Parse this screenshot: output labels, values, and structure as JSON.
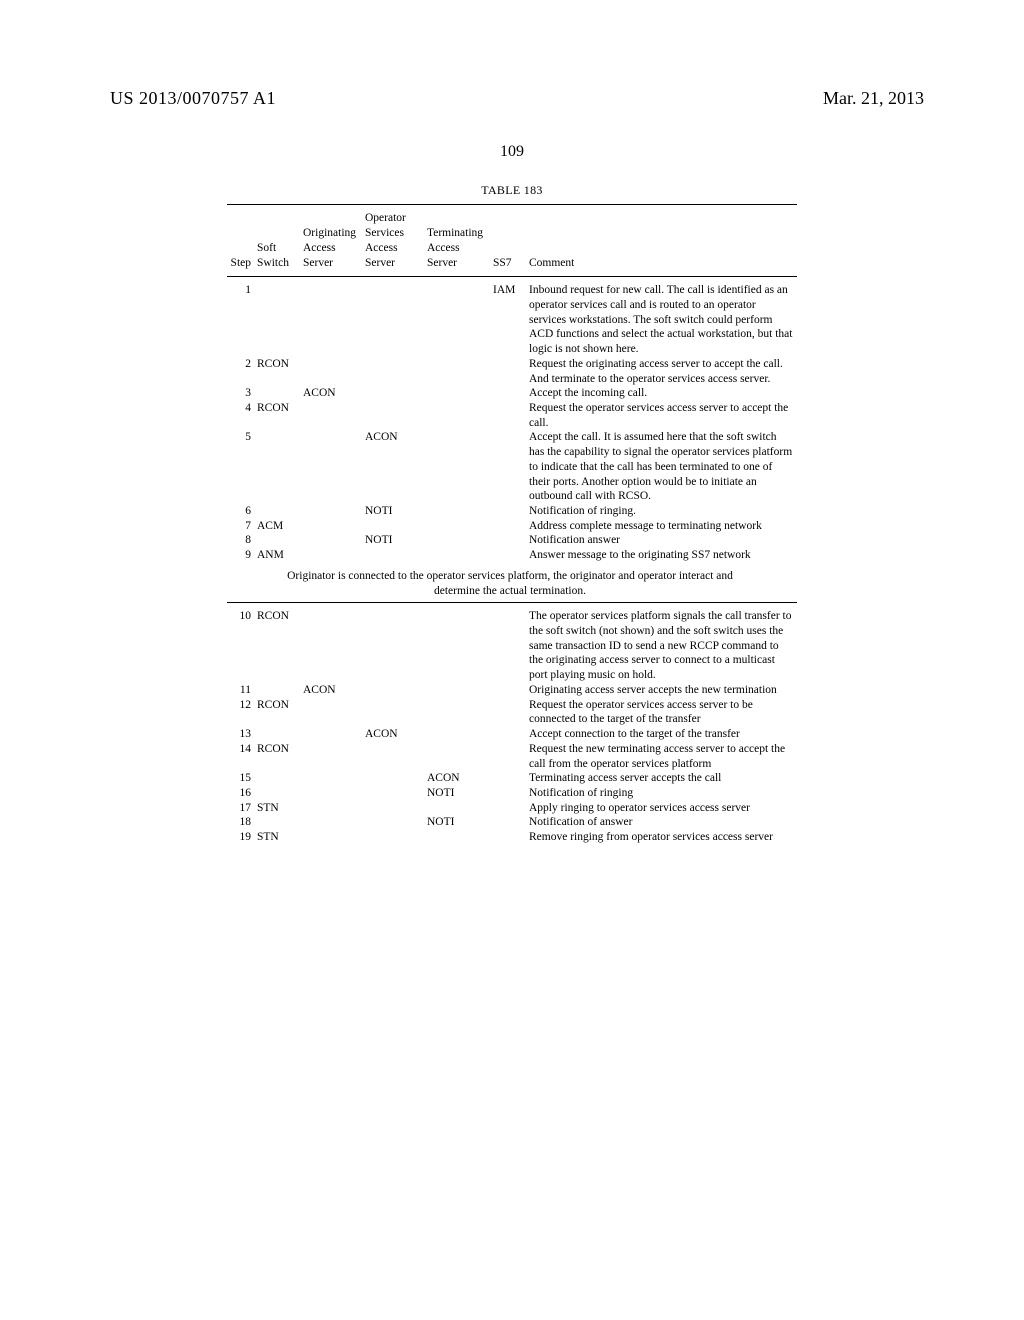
{
  "header": {
    "pub_number": "US 2013/0070757 A1",
    "pub_date": "Mar. 21, 2013",
    "page_number": "109"
  },
  "table": {
    "title": "TABLE 183",
    "columns": {
      "step": "Step",
      "soft_switch": "Soft\nSwitch",
      "orig_access": "Originating\nAccess\nServer",
      "op_services": "Operator\nServices\nAccess\nServer",
      "term_access": "Terminating\nAccess\nServer",
      "ss7": "SS7",
      "comment": "Comment"
    },
    "separator": "Originator is connected to the operator services platform, the originator and operator interact and determine the actual termination.",
    "rows_top": [
      {
        "step": "1",
        "switch": "",
        "oas": "",
        "osas": "",
        "tas": "",
        "ss7": "IAM",
        "comment": "Inbound request for new call. The call is identified as an operator services call and is routed to an operator services workstations. The soft switch could perform ACD functions and select the actual workstation, but that logic is not shown here."
      },
      {
        "step": "2",
        "switch": "RCON",
        "oas": "",
        "osas": "",
        "tas": "",
        "ss7": "",
        "comment": "Request the originating access server to accept the call. And terminate to the operator services access server."
      },
      {
        "step": "3",
        "switch": "",
        "oas": "ACON",
        "osas": "",
        "tas": "",
        "ss7": "",
        "comment": "Accept the incoming call."
      },
      {
        "step": "4",
        "switch": "RCON",
        "oas": "",
        "osas": "",
        "tas": "",
        "ss7": "",
        "comment": "Request the operator services access server to accept the call."
      },
      {
        "step": "5",
        "switch": "",
        "oas": "",
        "osas": "ACON",
        "tas": "",
        "ss7": "",
        "comment": "Accept the call. It is assumed here that the soft switch has the capability to signal the operator services platform to indicate that the call has been terminated to one of their ports. Another option would be to initiate an outbound call with RCSO."
      },
      {
        "step": "6",
        "switch": "",
        "oas": "",
        "osas": "NOTI",
        "tas": "",
        "ss7": "",
        "comment": "Notification of ringing."
      },
      {
        "step": "7",
        "switch": "ACM",
        "oas": "",
        "osas": "",
        "tas": "",
        "ss7": "",
        "comment": "Address complete message to terminating network"
      },
      {
        "step": "8",
        "switch": "",
        "oas": "",
        "osas": "NOTI",
        "tas": "",
        "ss7": "",
        "comment": "Notification answer"
      },
      {
        "step": "9",
        "switch": "ANM",
        "oas": "",
        "osas": "",
        "tas": "",
        "ss7": "",
        "comment": "Answer message to the originating SS7 network"
      }
    ],
    "rows_bottom": [
      {
        "step": "10",
        "switch": "RCON",
        "oas": "",
        "osas": "",
        "tas": "",
        "ss7": "",
        "comment": "The operator services platform signals the call transfer to the soft switch (not shown) and the soft switch uses the same transaction ID to send a new RCCP command to the originating access server to connect to a multicast port playing music on hold."
      },
      {
        "step": "11",
        "switch": "",
        "oas": "ACON",
        "osas": "",
        "tas": "",
        "ss7": "",
        "comment": "Originating access server accepts the new termination"
      },
      {
        "step": "12",
        "switch": "RCON",
        "oas": "",
        "osas": "",
        "tas": "",
        "ss7": "",
        "comment": "Request the operator services access server to be connected to the target of the transfer"
      },
      {
        "step": "13",
        "switch": "",
        "oas": "",
        "osas": "ACON",
        "tas": "",
        "ss7": "",
        "comment": "Accept connection to the target of the transfer"
      },
      {
        "step": "14",
        "switch": "RCON",
        "oas": "",
        "osas": "",
        "tas": "",
        "ss7": "",
        "comment": "Request the new terminating access server to accept the call from the operator services platform"
      },
      {
        "step": "15",
        "switch": "",
        "oas": "",
        "osas": "",
        "tas": "ACON",
        "ss7": "",
        "comment": "Terminating access server accepts the call"
      },
      {
        "step": "16",
        "switch": "",
        "oas": "",
        "osas": "",
        "tas": "NOTI",
        "ss7": "",
        "comment": "Notification of ringing"
      },
      {
        "step": "17",
        "switch": "STN",
        "oas": "",
        "osas": "",
        "tas": "",
        "ss7": "",
        "comment": "Apply ringing to operator services access server"
      },
      {
        "step": "18",
        "switch": "",
        "oas": "",
        "osas": "",
        "tas": "NOTI",
        "ss7": "",
        "comment": "Notification of answer"
      },
      {
        "step": "19",
        "switch": "STN",
        "oas": "",
        "osas": "",
        "tas": "",
        "ss7": "",
        "comment": "Remove ringing from operator services access server"
      }
    ]
  }
}
